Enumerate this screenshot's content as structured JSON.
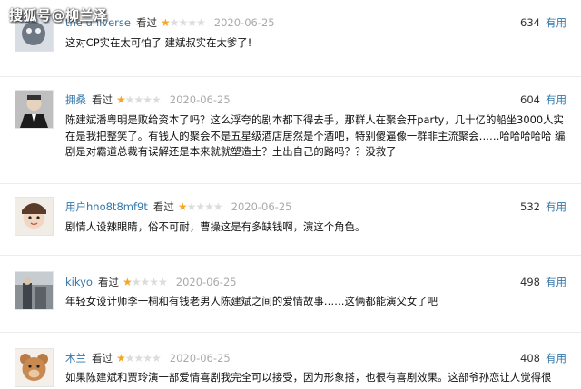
{
  "watermark": "搜狐号@柳兰泽",
  "watched_label": "看过",
  "useful_label": "有用",
  "colors": {
    "link": "#3377aa",
    "star": "#f5a623",
    "date": "#aaaaaa"
  },
  "reviews": [
    {
      "username": "the universe",
      "rating": 1,
      "date": "2020-06-25",
      "votes": "634",
      "content": "这对CP实在太可怕了 建斌叔实在太爹了!",
      "avatar_icon": "cat-avatar"
    },
    {
      "username": "拥桑",
      "rating": 1,
      "date": "2020-06-25",
      "votes": "604",
      "content": "陈建斌潘粤明是败给资本了吗？这么浮夸的剧本都下得去手，那群人在聚会开party，几十亿的船坐3000人实在是我把整笑了。有钱人的聚会不是五星级酒店居然是个酒吧，特别傻逼像一群非主流聚会……哈哈哈哈哈 编剧是对霸道总裁有误解还是本来就就塑造土？土出自己的路吗？？没救了",
      "avatar_icon": "man-in-suit-avatar"
    },
    {
      "username": "用户hno8t8mf9t",
      "rating": 1,
      "date": "2020-06-25",
      "votes": "532",
      "content": "剧情人设辣眼睛，俗不可耐，曹操这是有多缺钱啊，演这个角色。",
      "avatar_icon": "baby-avatar"
    },
    {
      "username": "kikyo",
      "rating": 1,
      "date": "2020-06-25",
      "votes": "498",
      "content": "年轻女设计师李一桐和有钱老男人陈建斌之间的爱情故事……这俩都能演父女了吧",
      "avatar_icon": "photo-avatar"
    },
    {
      "username": "木兰",
      "rating": 1,
      "date": "2020-06-25",
      "votes": "408",
      "content": "如果陈建斌和贾玲演一部爱情喜剧我完全可以接受，因为形象搭，也很有喜剧效果。这部爷孙恋让人觉得很",
      "avatar_icon": "teddy-bear-avatar"
    }
  ]
}
